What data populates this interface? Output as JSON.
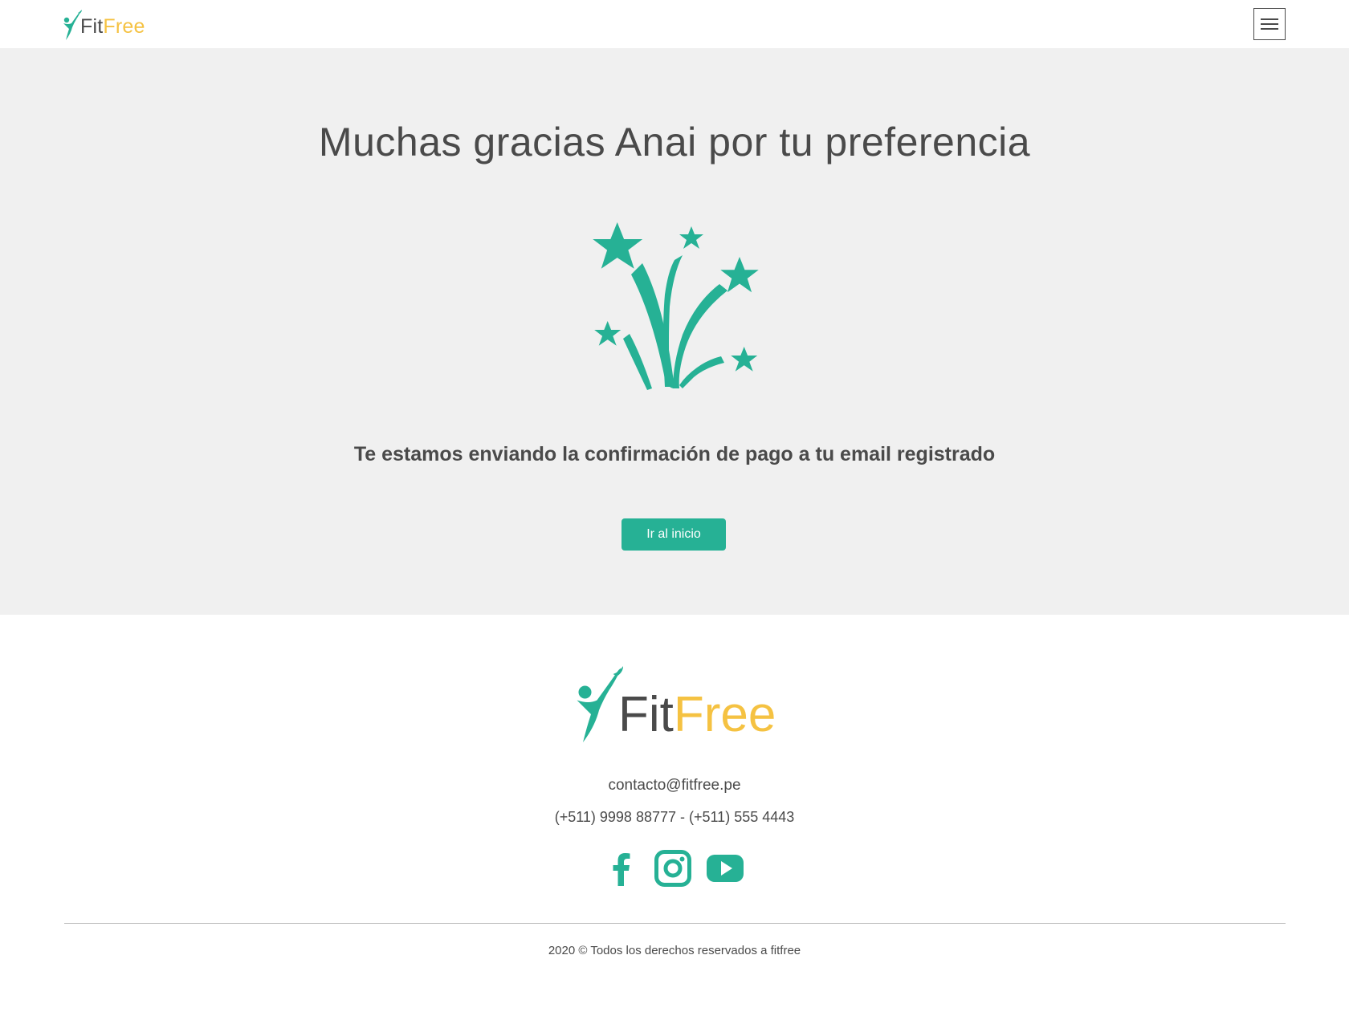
{
  "brand": {
    "name_part1": "Fit",
    "name_part2": "Free",
    "color_primary": "#26b195",
    "color_accent": "#f5c242",
    "color_text": "#4a4a4a"
  },
  "header": {
    "logo_icon": "runner-icon",
    "menu_icon": "hamburger-menu-icon"
  },
  "hero": {
    "title": "Muchas gracias Anai por tu preferencia",
    "illustration_icon": "fireworks-icon",
    "subtitle": "Te estamos enviando la confirmación de pago a tu email registrado",
    "button_label": "Ir al inicio",
    "background_color": "#f0f0f0"
  },
  "footer": {
    "email": "contacto@fitfree.pe",
    "phones": "(+511) 9998 88777 - (+511) 555 4443",
    "social": [
      {
        "name": "facebook-icon"
      },
      {
        "name": "instagram-icon"
      },
      {
        "name": "youtube-icon"
      }
    ],
    "copyright": "2020 © Todos los derechos reservados a fitfree"
  }
}
